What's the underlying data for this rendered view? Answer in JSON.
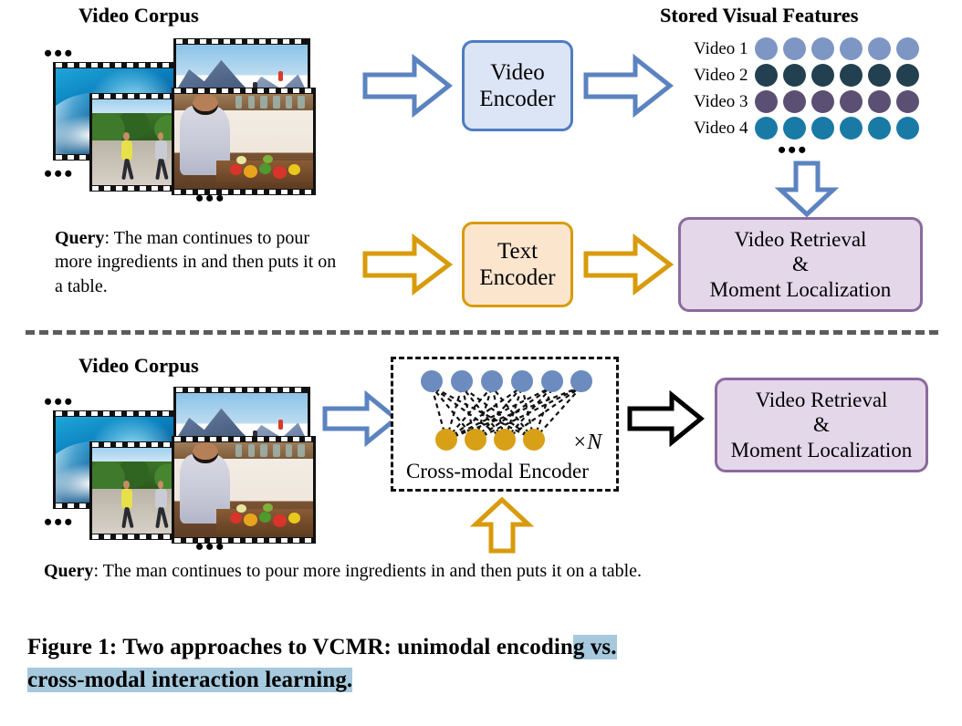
{
  "figure": {
    "caption_line1_plain": "Figure 1: Two approaches to VCMR: unimodal encodin",
    "caption_line1_highlight": "g vs.",
    "caption_line2_highlight": "cross-modal interaction learning.",
    "caption_full": "Figure 1: Two approaches to VCMR: unimodal encoding vs. cross-modal interaction learning.",
    "highlight_color": "#a6c9dd"
  },
  "top_section": {
    "corpus_title": "Video Corpus",
    "features_title": "Stored Visual Features",
    "ellipsis": "•••",
    "video_encoder": {
      "line1": "Video",
      "line2": "Encoder",
      "fill": "#dbe5f6",
      "border": "#4f7cc0"
    },
    "text_encoder": {
      "line1": "Text",
      "line2": "Encoder",
      "fill": "#fce5cd",
      "border": "#d89b0b"
    },
    "output_box": {
      "line1": "Video Retrieval",
      "line2": "&",
      "line3": "Moment Localization",
      "fill": "#e5d7ea",
      "border": "#8b6a9c"
    },
    "query": {
      "label": "Query",
      "separator": ": ",
      "text": "The man continues to pour more ingredients in and then puts it on a table."
    },
    "feature_rows": [
      {
        "label": "Video 1",
        "color": "#7e96c4",
        "count": 6
      },
      {
        "label": "Video 2",
        "color": "#22404f",
        "count": 6
      },
      {
        "label": "Video 3",
        "color": "#5b4f73",
        "count": 6
      },
      {
        "label": "Video 4",
        "color": "#1a7aa6",
        "count": 6
      }
    ],
    "arrows": {
      "corpus_to_video_encoder": "right-arrow-blue",
      "video_encoder_to_features": "right-arrow-blue",
      "query_to_text_encoder": "right-arrow-gold",
      "text_encoder_to_output": "right-arrow-gold",
      "features_to_output": "down-arrow-blue"
    },
    "thumbnails": [
      {
        "name": "surfing-wave"
      },
      {
        "name": "skiing-mountain"
      },
      {
        "name": "runners-road"
      },
      {
        "name": "cooking-vegetables"
      }
    ]
  },
  "bottom_section": {
    "corpus_title": "Video Corpus",
    "ellipsis": "•••",
    "cross_modal_encoder": {
      "label": "Cross-modal Encoder",
      "repeat_label": "×N",
      "top_dot_color": "#6c8cbf",
      "bottom_dot_color": "#d7a017",
      "top_dot_count": 6,
      "bottom_dot_count": 4
    },
    "output_box": {
      "line1": "Video Retrieval",
      "line2": "&",
      "line3": "Moment Localization",
      "fill": "#e5d7ea",
      "border": "#8b6a9c"
    },
    "query": {
      "label": "Query",
      "separator": ": ",
      "text": "The man continues to pour more ingredients in and then puts it on a table."
    },
    "arrows": {
      "corpus_to_encoder": "right-arrow-blue",
      "encoder_to_output": "right-arrow-black",
      "query_to_encoder": "up-arrow-gold"
    },
    "thumbnails": [
      {
        "name": "surfing-wave"
      },
      {
        "name": "skiing-mountain"
      },
      {
        "name": "runners-road"
      },
      {
        "name": "cooking-vegetables"
      }
    ]
  }
}
